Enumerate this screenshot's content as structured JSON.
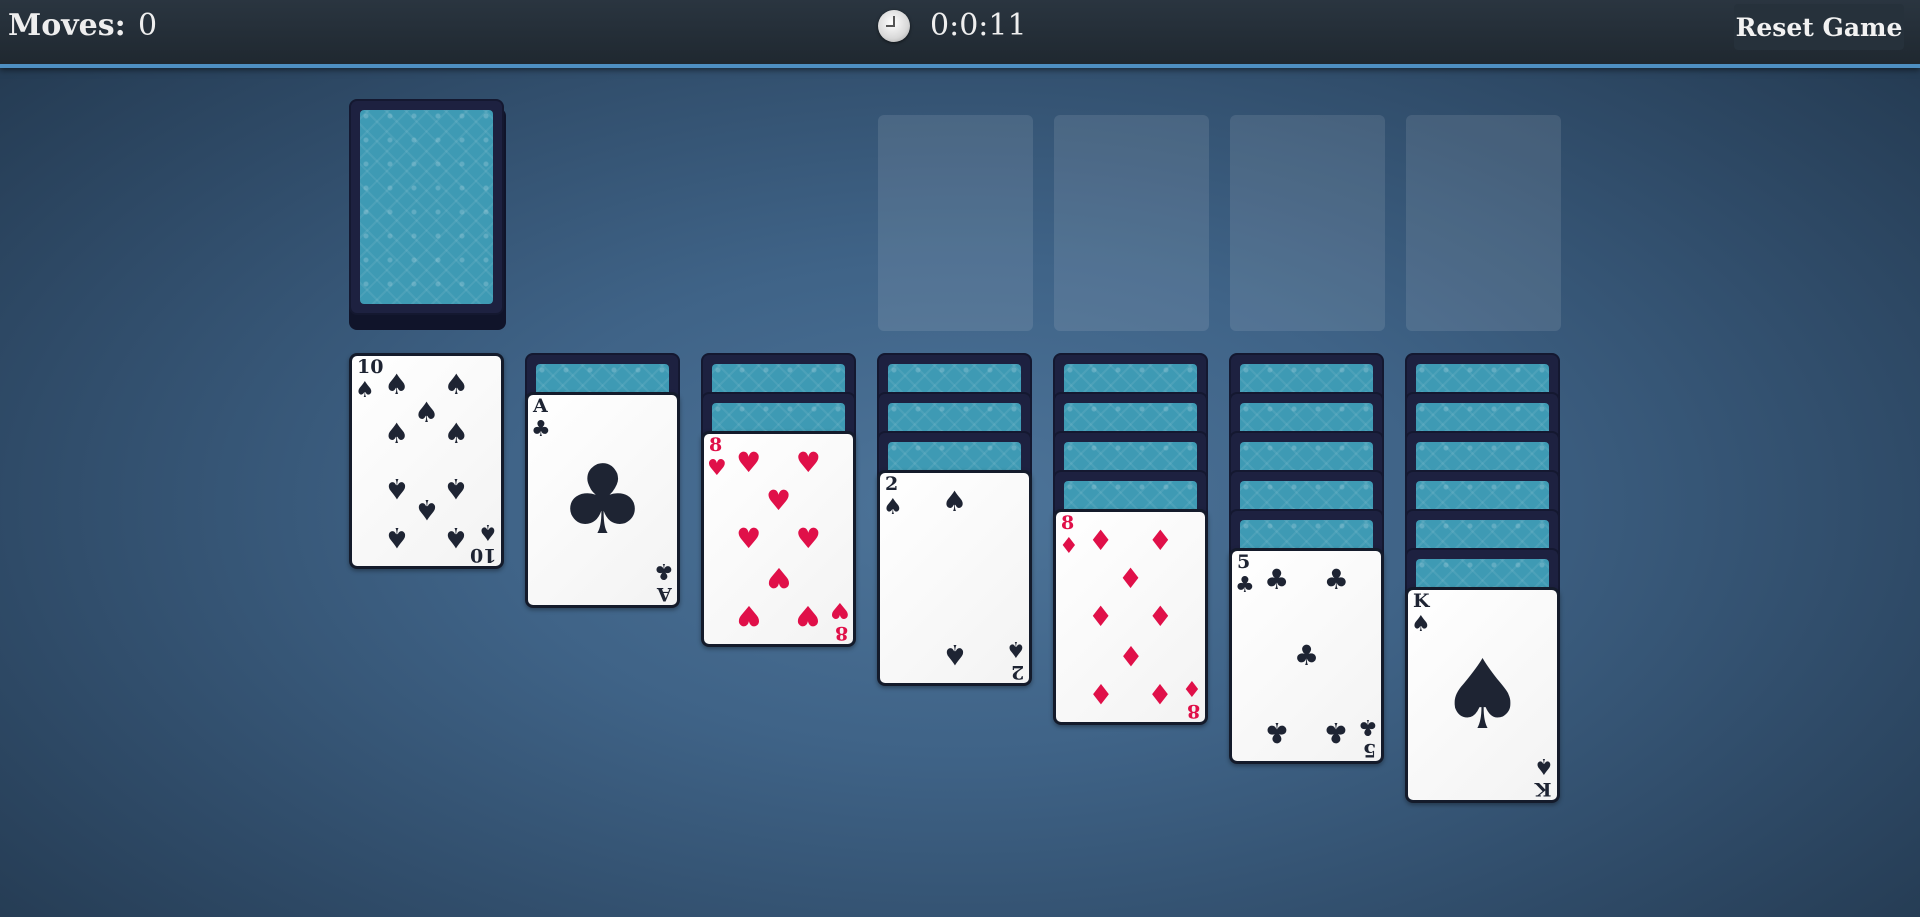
{
  "header": {
    "moves_label": "Moves:",
    "moves_value": "0",
    "timer": "0:0:11",
    "reset_label": "Reset Game"
  },
  "colors": {
    "red_suit": "#e01049",
    "black_suit": "#1e2433",
    "card_back": "#3e9ab4",
    "header_accent": "#4e8fc2"
  },
  "icons": {
    "clock": "clock-icon",
    "stock": "card-back"
  },
  "tableau": [
    {
      "face_down": 0,
      "rank": "10",
      "suit": "♠",
      "color": "black"
    },
    {
      "face_down": 1,
      "rank": "A",
      "suit": "♣",
      "color": "black"
    },
    {
      "face_down": 2,
      "rank": "8",
      "suit": "♥",
      "color": "red"
    },
    {
      "face_down": 3,
      "rank": "2",
      "suit": "♠",
      "color": "black"
    },
    {
      "face_down": 4,
      "rank": "8",
      "suit": "♦",
      "color": "red"
    },
    {
      "face_down": 5,
      "rank": "5",
      "suit": "♣",
      "color": "black"
    },
    {
      "face_down": 6,
      "rank": "K",
      "suit": "♠",
      "color": "black"
    }
  ]
}
